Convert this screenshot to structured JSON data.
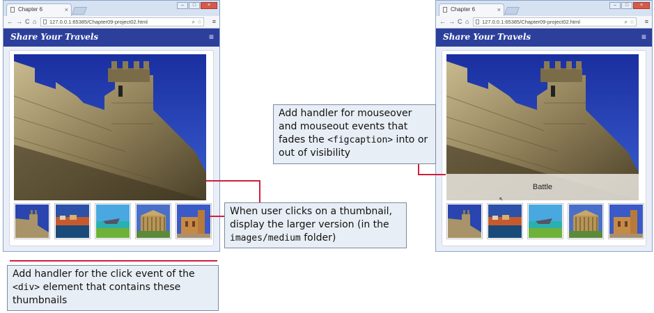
{
  "browser": {
    "tab_title": "Chapter 6",
    "tab_close": "×",
    "url": "127.0.0.1:65385/Chapter09-project02.html",
    "nav": {
      "back": "←",
      "forward": "→",
      "reload": "C",
      "home": "⌂"
    },
    "window_buttons": {
      "minimize": "–",
      "maximize": "□",
      "close": "×"
    },
    "menu_icon": "≡"
  },
  "app": {
    "brand": "Share Your Travels",
    "hamburger_icon": "≡"
  },
  "right_view": {
    "caption": "Battle"
  },
  "thumbnails": [
    {
      "icon": "castle-thumbnail"
    },
    {
      "icon": "harbor-thumbnail"
    },
    {
      "icon": "shipwreck-thumbnail"
    },
    {
      "icon": "temple-thumbnail"
    },
    {
      "icon": "church-thumbnail"
    }
  ],
  "callouts": {
    "mouseover": {
      "part1": "Add handler for mouseover and mouseout events that fades the ",
      "tag": "<figcaption>",
      "part2": " into or out of visibility"
    },
    "thumbnail_click": {
      "part1": "When user clicks on a thumbnail, display the larger version (in the ",
      "folder": "images/medium",
      "part2": " folder)"
    },
    "div_click": {
      "part1": "Add handler for the click event of the ",
      "tag": "<div>",
      "part2": " element that contains these thumbnails"
    }
  },
  "colors": {
    "accent": "#2b3f9b",
    "annotation_line": "#d11d3a",
    "callout_bg": "#e8eef5"
  }
}
